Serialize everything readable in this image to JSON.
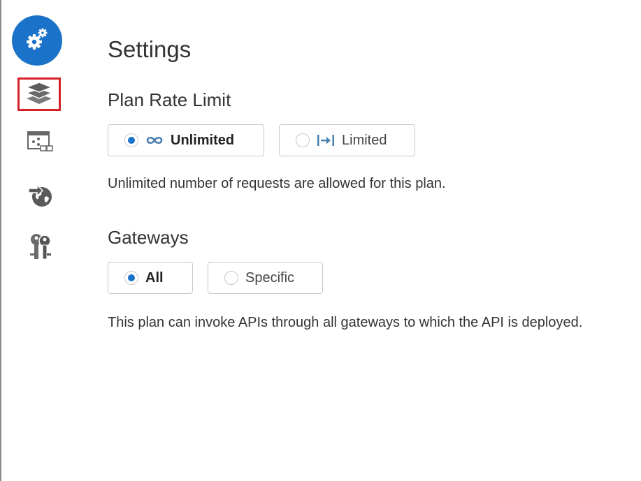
{
  "sidebar": {
    "items": [
      {
        "icon": "gears-icon",
        "active": true
      },
      {
        "icon": "layers-icon",
        "highlighted": true
      },
      {
        "icon": "diagram-window-icon"
      },
      {
        "icon": "globe-arrow-icon"
      },
      {
        "icon": "keys-icon"
      }
    ]
  },
  "main": {
    "title": "Settings",
    "rate_limit": {
      "heading": "Plan Rate Limit",
      "options": [
        {
          "label": "Unlimited",
          "icon": "infinity-icon",
          "selected": true
        },
        {
          "label": "Limited",
          "icon": "limit-arrow-icon",
          "selected": false
        }
      ],
      "description": "Unlimited number of requests are allowed for this plan."
    },
    "gateways": {
      "heading": "Gateways",
      "options": [
        {
          "label": "All",
          "selected": true
        },
        {
          "label": "Specific",
          "selected": false
        }
      ],
      "description": "This plan can invoke APIs through all gateways to which the API is deployed."
    }
  },
  "colors": {
    "accent": "#1a73c8",
    "highlight_box": "#d6232a",
    "icon_gray": "#666666",
    "limit_icon": "#4a7fb0"
  }
}
